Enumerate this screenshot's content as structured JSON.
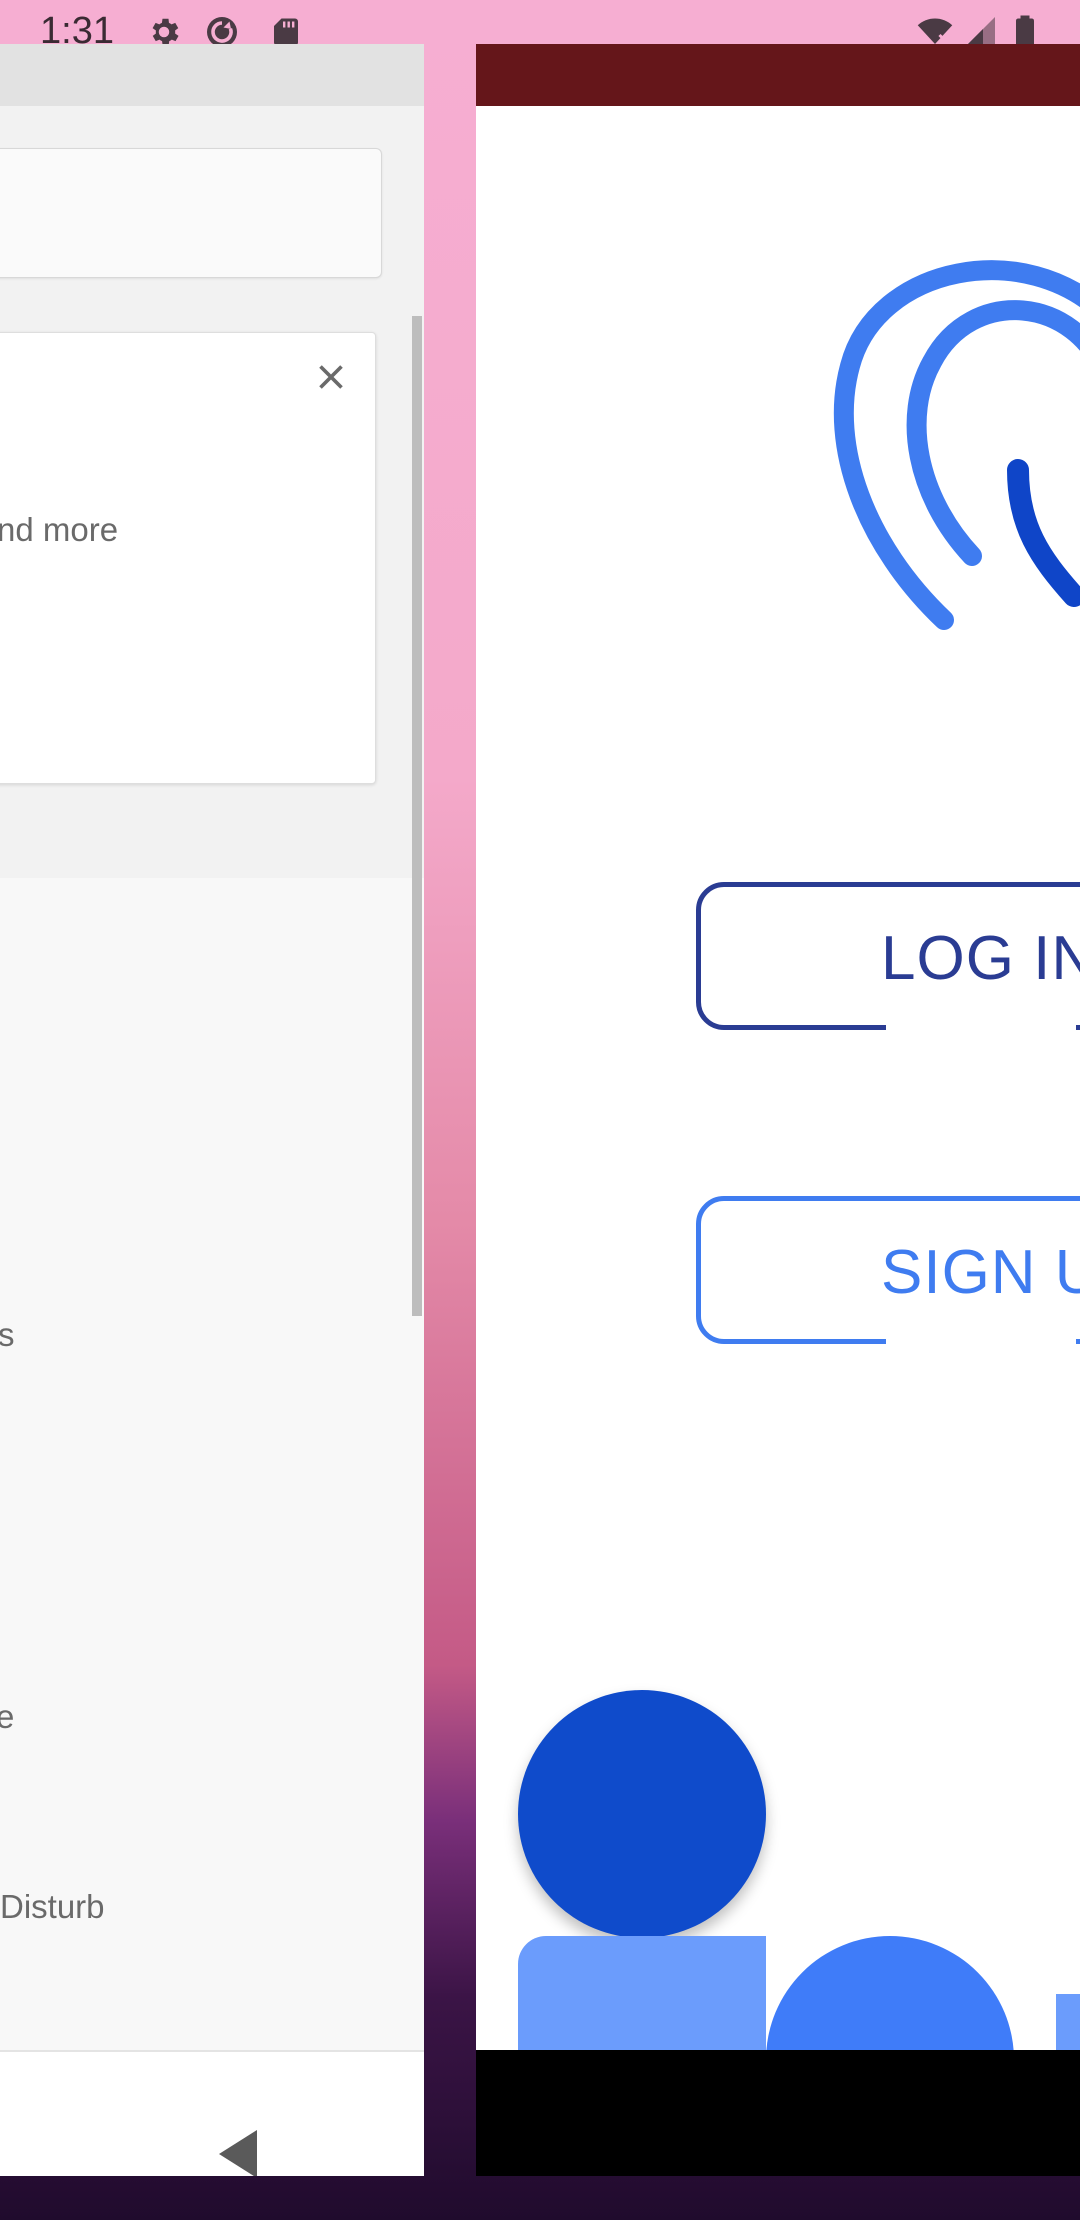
{
  "status_bar": {
    "time": "1:31",
    "icons": [
      "gear-icon",
      "sync-icon",
      "sd-card-icon",
      "wifi-icon",
      "cell-signal-icon",
      "battery-icon"
    ]
  },
  "left_window": {
    "suggestion_text": "nd more",
    "list_fragments": [
      "s",
      "e",
      " Disturb"
    ],
    "icons": [
      "close-icon",
      "back-icon"
    ]
  },
  "right_window": {
    "login_label": "LOG IN",
    "signup_label": "SIGN U",
    "icons": [
      "fingerprint-icon"
    ],
    "colors": {
      "toolbar": "#65161a",
      "login_outline": "#2a3c93",
      "signup_outline": "#3f7cf0",
      "fingerprint_outer": "#3f7cf0",
      "fingerprint_inner": "#0f45c8"
    }
  }
}
